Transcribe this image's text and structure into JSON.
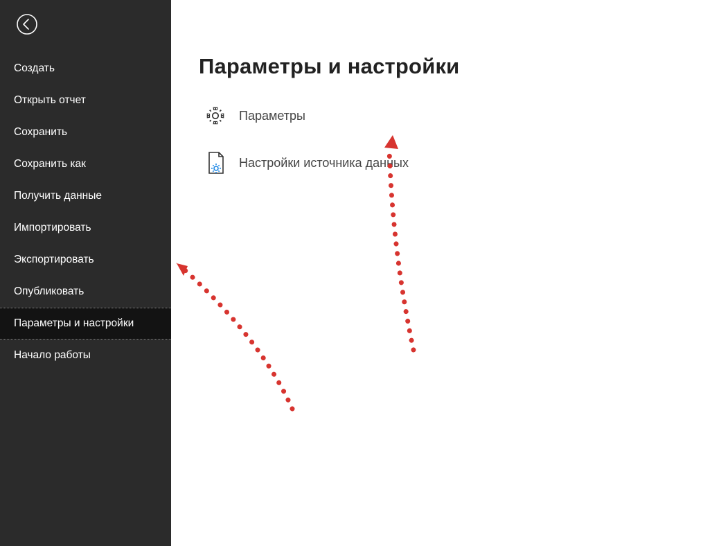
{
  "sidebar": {
    "items": [
      {
        "label": "Создать"
      },
      {
        "label": "Открыть отчет"
      },
      {
        "label": "Сохранить"
      },
      {
        "label": "Сохранить как"
      },
      {
        "label": "Получить данные"
      },
      {
        "label": "Импортировать"
      },
      {
        "label": "Экспортировать"
      },
      {
        "label": "Опубликовать"
      },
      {
        "label": "Параметры и настройки"
      },
      {
        "label": "Начало работы"
      }
    ],
    "selected_index": 8
  },
  "main": {
    "title": "Параметры и настройки",
    "options": [
      {
        "label": "Параметры",
        "icon": "gear-icon"
      },
      {
        "label": "Настройки источника данных",
        "icon": "datasource-settings-icon"
      }
    ]
  }
}
